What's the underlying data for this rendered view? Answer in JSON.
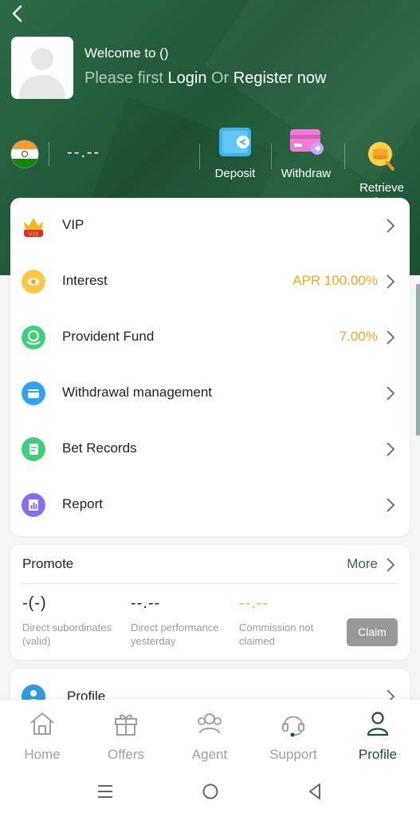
{
  "header": {
    "welcome": "Welcome to ()",
    "please_first": "Please first",
    "login": "Login",
    "or": "Or",
    "register": "Register now",
    "balance": "--.--",
    "actions": [
      {
        "label": "Deposit",
        "icon": "deposit-icon"
      },
      {
        "label": "Withdraw",
        "icon": "withdraw-icon"
      },
      {
        "label": "Retrieve\nBalance",
        "icon": "retrieve-balance-icon"
      }
    ]
  },
  "menu": {
    "items": [
      {
        "label": "VIP",
        "value": "",
        "icon": "vip-crown-icon",
        "badge": "V10"
      },
      {
        "label": "Interest",
        "value": "APR 100.00%",
        "icon": "interest-icon"
      },
      {
        "label": "Provident Fund",
        "value": "7.00%",
        "icon": "provident-fund-icon"
      },
      {
        "label": "Withdrawal management",
        "value": "",
        "icon": "wallet-icon"
      },
      {
        "label": "Bet Records",
        "value": "",
        "icon": "bet-records-icon"
      },
      {
        "label": "Report",
        "value": "",
        "icon": "report-icon"
      }
    ]
  },
  "promote": {
    "title": "Promote",
    "more": "More",
    "stats": [
      {
        "value": "-(-)",
        "label": "Direct subordinates\n(valid)"
      },
      {
        "value": "--.--",
        "label": "Direct performance\nyesterday"
      },
      {
        "value": "--.--",
        "label": "Commission not\nclaimed"
      }
    ],
    "claim": "Claim"
  },
  "profile_row": {
    "label": "Profile"
  },
  "tabs": [
    {
      "label": "Home",
      "icon": "home-icon"
    },
    {
      "label": "Offers",
      "icon": "gift-icon"
    },
    {
      "label": "Agent",
      "icon": "agent-icon"
    },
    {
      "label": "Support",
      "icon": "headset-icon"
    },
    {
      "label": "Profile",
      "icon": "user-icon",
      "active": true
    }
  ],
  "colors": {
    "brand_green": "#2d6b47",
    "accent_orange": "#f0a820",
    "tab_inactive": "#9aa0a6"
  }
}
